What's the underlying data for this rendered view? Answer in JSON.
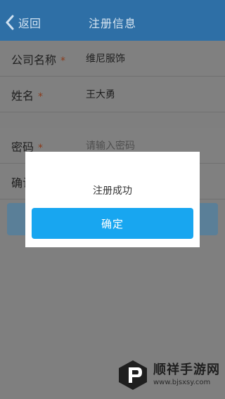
{
  "header": {
    "back_label": "返回",
    "title": "注册信息"
  },
  "form": {
    "company_label": "公司名称",
    "company_value": "维尼服饰",
    "name_label": "姓名",
    "name_value": "王大勇",
    "password_label": "密码",
    "password_placeholder": "请输入密码",
    "confirm_label": "确认密码",
    "required_mark": "*"
  },
  "dialog": {
    "message": "注册成功",
    "ok_label": "确定"
  },
  "watermark": {
    "name": "顺祥手游网",
    "url": "www.bjsxsy.com"
  },
  "colors": {
    "header": "#2e6fa6",
    "dialog_button": "#18a6f0",
    "overlay_bg": "#7f7f7f"
  }
}
